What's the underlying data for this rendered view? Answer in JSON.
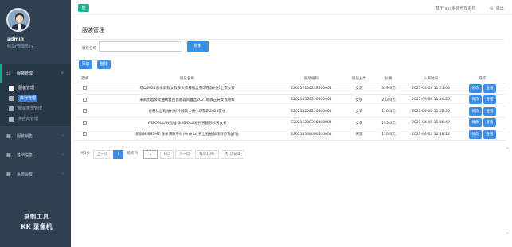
{
  "sidebar": {
    "user_name": "admin",
    "user_role": "科员(管理员)",
    "menu": [
      {
        "label": "服装管理",
        "icon": "list-icon",
        "open": true
      },
      {
        "label": "服装销售",
        "icon": "grid-icon"
      },
      {
        "label": "基础信息",
        "icon": "grid-icon"
      },
      {
        "label": "系统设置",
        "icon": "grid-icon"
      }
    ],
    "submenu": [
      {
        "label": "服装管理",
        "active": true
      },
      {
        "label": "库存管理",
        "selected": true
      },
      {
        "label": "服装类型管理"
      },
      {
        "label": "供应商管理"
      }
    ],
    "watermark_line1": "录制工具",
    "watermark_line2": "KK 录像机"
  },
  "topbar": {
    "toggle_icon": "≡",
    "system_title": "基于Java服装管理系统",
    "exit_label": "退出",
    "exit_icon": "⊖"
  },
  "main": {
    "page_title": "服装管理",
    "search_label": "服装名称",
    "search_value": "",
    "search_button": "搜索",
    "add_button": "添加",
    "delete_button": "删除"
  },
  "table": {
    "headers": [
      "选择",
      "服装名称",
      "服装编码",
      "服装分类",
      "价格",
      "入库时间",
      "操作"
    ],
    "rows": [
      {
        "name": "马山2021春季新款女款多头衣暴服丝雪印花款衬衫上衣女衣",
        "code": "E20212108230400001",
        "category": "女装",
        "price": "329.0元",
        "time": "2021-04-06 11:21:03"
      },
      {
        "name": "米莉比超帝梵抽绣复古优雅森风蕾丝2021新款正肩女春春料",
        "code": "E20214508230400001",
        "category": "女装",
        "price": "233.0元",
        "time": "2021-04-06 11:46:26"
      },
      {
        "name": "谷丽比丝短袖衬衫外翻领卡通小印花刺2021夏季",
        "code": "E20218208230400001",
        "category": "女装",
        "price": "120.0元",
        "time": "2021-04-06 11:52:50"
      },
      {
        "name": "WIZCOLLAN短袖 休闲POLO短衫男翻领衫男女衫",
        "code": "E20215208230400001",
        "category": "女装",
        "price": "125.0元",
        "time": "2021-04-06 11:36:49"
      },
      {
        "name": "新款休闲BSMZ 春季薄款平纹(Pirdrib) 男士短袖翻领商务T恤T恤",
        "code": "E20216508090400001",
        "category": "男装",
        "price": "120.0元",
        "time": "2021-04-03 12:18:12"
      }
    ],
    "edit_label": "修改",
    "view_label": "查看"
  },
  "pager": {
    "total": "共5条",
    "prev": "上一页",
    "current_page": "1",
    "goto_label": "跳转到",
    "goto_value": "1",
    "go": "GO",
    "next": "下一页",
    "per_page": "每页10条",
    "total_pages": "共1页记录"
  }
}
